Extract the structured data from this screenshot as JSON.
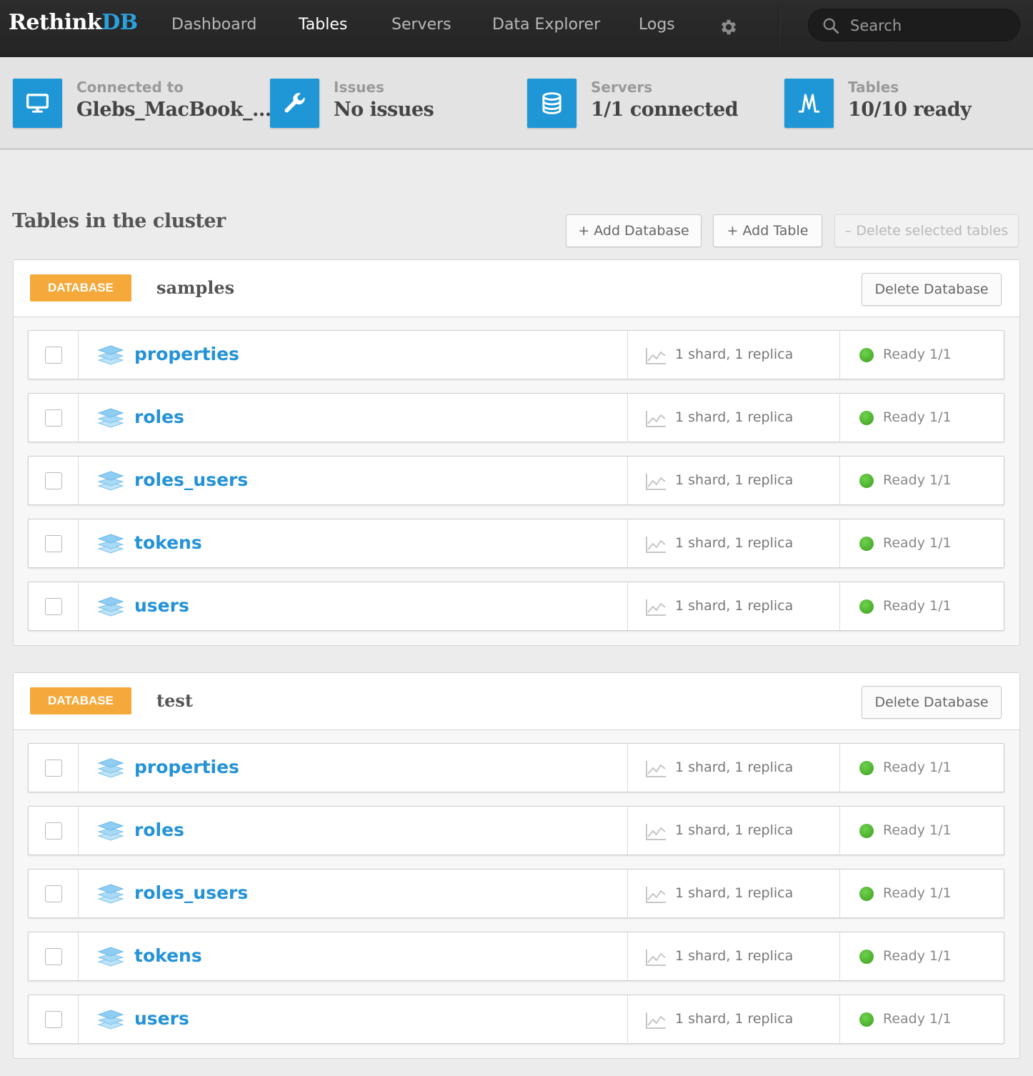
{
  "navbar": {
    "logo_main": "Rethink",
    "logo_accent": "DB",
    "items": [
      {
        "label": "Dashboard",
        "active": false
      },
      {
        "label": "Tables",
        "active": true
      },
      {
        "label": "Servers",
        "active": false
      },
      {
        "label": "Data Explorer",
        "active": false
      },
      {
        "label": "Logs",
        "active": false
      }
    ],
    "settings_icon": "gear-icon",
    "search": {
      "placeholder": "Search",
      "value": "",
      "icon": "search-icon"
    }
  },
  "status": [
    {
      "label": "Connected to",
      "value": "Glebs_MacBook_...",
      "icon": "monitor-icon"
    },
    {
      "label": "Issues",
      "value": "No issues",
      "icon": "wrench-icon"
    },
    {
      "label": "Servers",
      "value": "1/1 connected",
      "icon": "database-icon"
    },
    {
      "label": "Tables",
      "value": "10/10 ready",
      "icon": "tables-pulse-icon"
    }
  ],
  "main": {
    "title": "Tables in the cluster",
    "buttons": {
      "add_database": "+ Add Database",
      "add_table": "+ Add Table",
      "delete_selected": "– Delete selected tables"
    }
  },
  "databases": [
    {
      "badge": "DATABASE",
      "name": "samples",
      "delete_label": "Delete Database",
      "tables": [
        {
          "name": "properties",
          "shards": "1 shard, 1 replica",
          "status": "Ready 1/1",
          "checked": false
        },
        {
          "name": "roles",
          "shards": "1 shard, 1 replica",
          "status": "Ready 1/1",
          "checked": false
        },
        {
          "name": "roles_users",
          "shards": "1 shard, 1 replica",
          "status": "Ready 1/1",
          "checked": false
        },
        {
          "name": "tokens",
          "shards": "1 shard, 1 replica",
          "status": "Ready 1/1",
          "checked": false
        },
        {
          "name": "users",
          "shards": "1 shard, 1 replica",
          "status": "Ready 1/1",
          "checked": false
        }
      ]
    },
    {
      "badge": "DATABASE",
      "name": "test",
      "delete_label": "Delete Database",
      "tables": [
        {
          "name": "properties",
          "shards": "1 shard, 1 replica",
          "status": "Ready 1/1",
          "checked": false
        },
        {
          "name": "roles",
          "shards": "1 shard, 1 replica",
          "status": "Ready 1/1",
          "checked": false
        },
        {
          "name": "roles_users",
          "shards": "1 shard, 1 replica",
          "status": "Ready 1/1",
          "checked": false
        },
        {
          "name": "tokens",
          "shards": "1 shard, 1 replica",
          "status": "Ready 1/1",
          "checked": false
        },
        {
          "name": "users",
          "shards": "1 shard, 1 replica",
          "status": "Ready 1/1",
          "checked": false
        }
      ]
    }
  ],
  "colors": {
    "brand_blue": "#1f97d6",
    "link_blue": "#2492d6",
    "badge_orange": "#f5a93a",
    "ready_green": "#4cb82c"
  }
}
